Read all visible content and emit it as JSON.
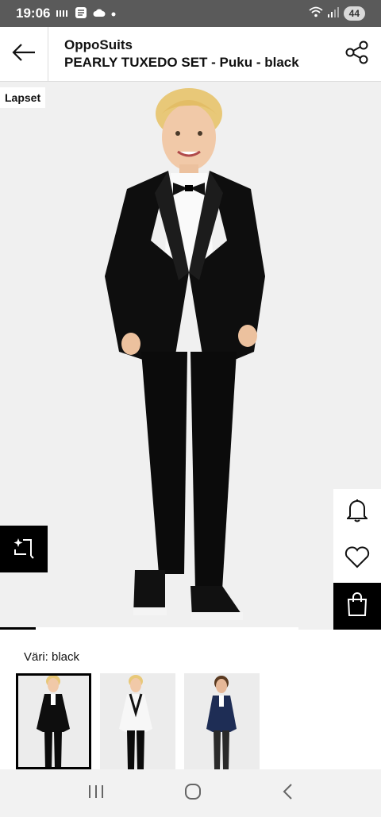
{
  "status_bar": {
    "time": "19:06",
    "battery": "44",
    "icons": [
      "signal-bars-icon",
      "app-notification-icon",
      "cloud-icon",
      "dot-icon",
      "wifi-icon",
      "cellular-icon"
    ]
  },
  "header": {
    "brand": "OppoSuits",
    "product_name": "PEARLY TUXEDO SET - Puku - black",
    "back_icon": "arrow-left-icon",
    "share_icon": "share-icon"
  },
  "product": {
    "category_tag": "Lapset",
    "image_progress": 0.12
  },
  "actions": {
    "ai_icon": "sparkle-crop-icon",
    "notify_icon": "bell-icon",
    "wishlist_icon": "heart-icon",
    "bag_icon": "shopping-bag-icon"
  },
  "color_section": {
    "label": "Väri: black",
    "swatches": [
      {
        "name": "black",
        "selected": true
      },
      {
        "name": "white",
        "selected": false
      },
      {
        "name": "navy",
        "selected": false
      }
    ]
  },
  "nav_bar": {
    "icons": [
      "recent-apps-icon",
      "home-icon",
      "back-icon"
    ]
  },
  "colors": {
    "status_bar": "#5a5a5a",
    "accent": "#000000",
    "image_bg": "#f0f0f0"
  }
}
